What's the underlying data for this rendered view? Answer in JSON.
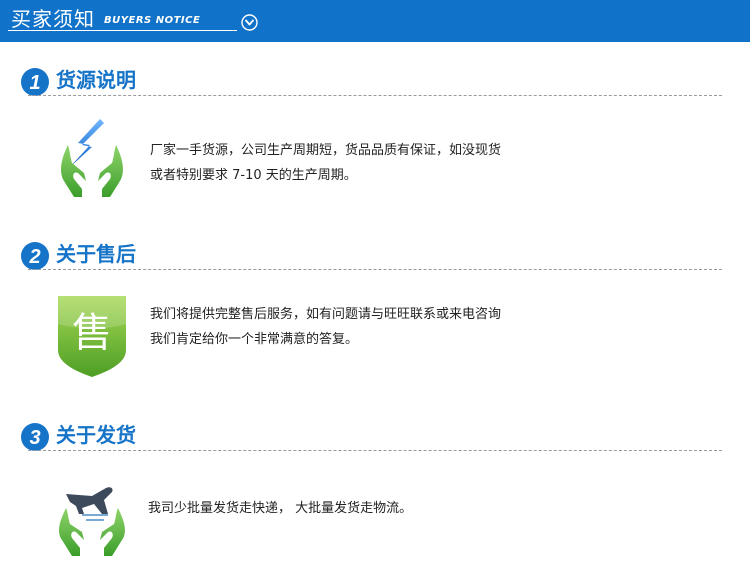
{
  "header": {
    "title": "买家须知",
    "subtitle": "BUYERS NOTICE",
    "background_color": "#1072c8",
    "chevron_icon": "chevron-down-circle-icon"
  },
  "accent_color": "#1573c8",
  "sections": [
    {
      "number": "1",
      "title": "货源说明",
      "icon": "bolt-hands-icon",
      "lines": [
        "厂家一手货源，公司生产周期短，货品品质有保证，如没现货",
        "或者特别要求 7-10 天的生产周期。"
      ]
    },
    {
      "number": "2",
      "title": "关于售后",
      "icon": "after-sales-shield-icon",
      "badge_char": "售",
      "lines": [
        "我们将提供完整售后服务，如有问题请与旺旺联系或来电咨询",
        "我们肯定给你一个非常满意的答复。"
      ]
    },
    {
      "number": "3",
      "title": "关于发货",
      "icon": "airplane-hands-icon",
      "lines": [
        "我司少批量发货走快递， 大批量发货走物流。"
      ]
    }
  ]
}
